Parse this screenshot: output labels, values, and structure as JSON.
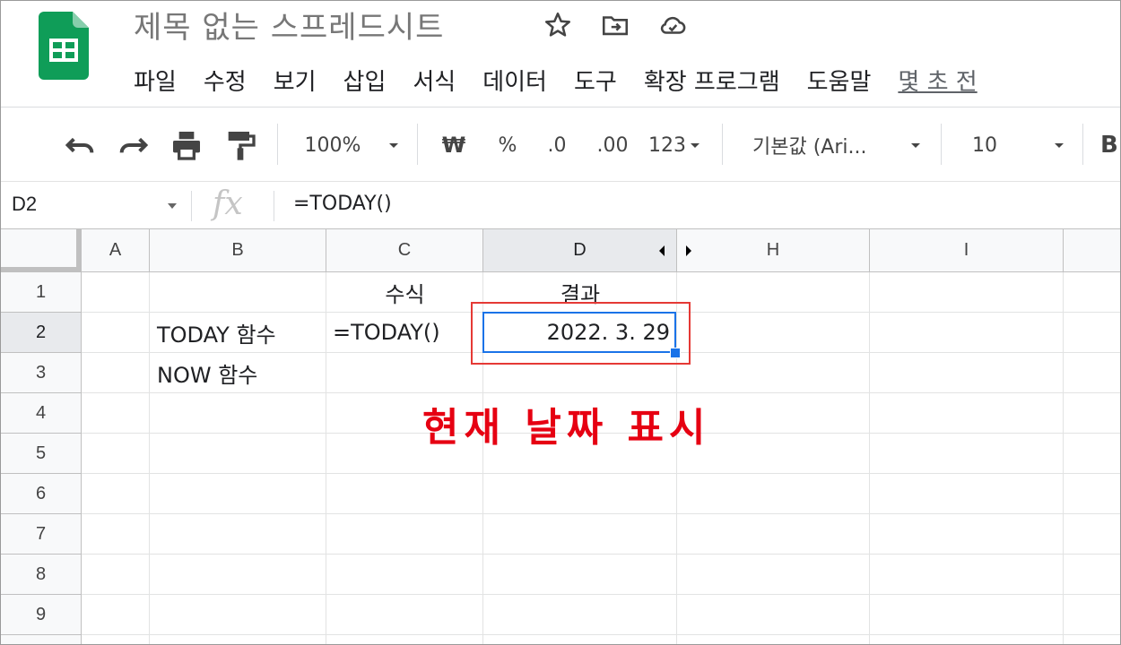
{
  "app": {
    "title": "제목 없는 스프레드시트",
    "brand_color": "#0f9d58"
  },
  "menu": [
    "파일",
    "수정",
    "보기",
    "삽입",
    "서식",
    "데이터",
    "도구",
    "확장 프로그램",
    "도움말",
    "몇 초 전"
  ],
  "toolbar": {
    "zoom": "100%",
    "currency": "₩",
    "percent": "%",
    "dec_decrease": ".0",
    "dec_increase": ".00",
    "number_format": "123",
    "font": "기본값 (Ari...",
    "font_size": "10",
    "bold": "B"
  },
  "formula_bar": {
    "name_box": "D2",
    "fx": "fx",
    "formula": "=TODAY()"
  },
  "grid": {
    "columns": [
      "A",
      "B",
      "C",
      "D",
      "H",
      "I"
    ],
    "selected_column": "D",
    "rows": [
      "1",
      "2",
      "3",
      "4",
      "5",
      "6",
      "7",
      "8",
      "9"
    ],
    "selected_row": "2",
    "cells": {
      "C1": "수식",
      "D1": "결과",
      "B2": "TODAY 함수",
      "C2": "=TODAY()",
      "D2": "2022. 3. 29",
      "B3": "NOW 함수"
    }
  },
  "annotation": "현재 날짜 표시",
  "colors": {
    "selection": "#1a73e8",
    "annotation": "#e60012"
  }
}
